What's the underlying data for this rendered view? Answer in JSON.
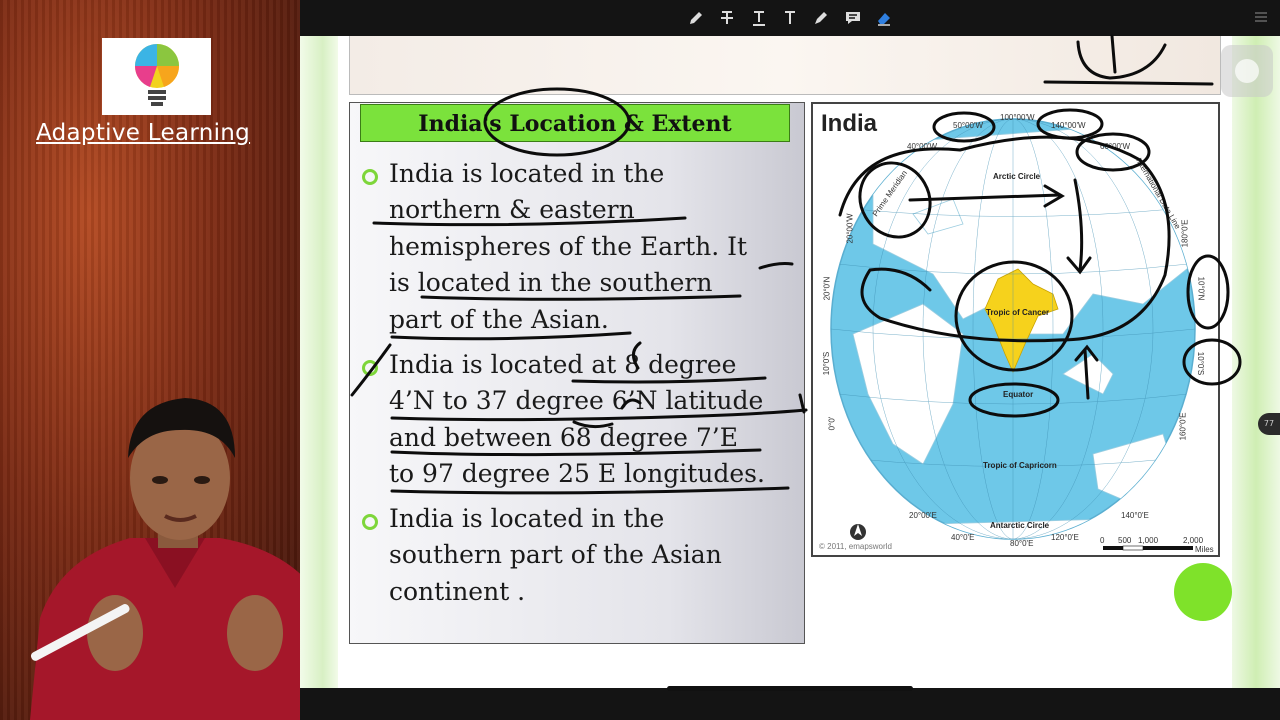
{
  "brand": {
    "name": "Adaptive Learning"
  },
  "toolbar": {
    "tools": [
      "pen-icon",
      "text-strike-icon",
      "text-underline-icon",
      "text-icon",
      "marker-icon",
      "comment-icon",
      "eraser-icon"
    ],
    "menu_icon": "menu-icon"
  },
  "slide": {
    "title": "India's Location & Extent",
    "bullets": [
      {
        "lines": [
          "India is located in the",
          "northern & eastern",
          "hemispheres of the Earth. It",
          "is located in the southern",
          "part of the Asian."
        ]
      },
      {
        "lines": [
          "India is located at 8 degree",
          "4’N to 37 degree 6’N latitude",
          "and between 68 degree 7’E",
          "to 97 degree 25 E longitudes."
        ]
      },
      {
        "lines": [
          "India is located in the",
          "southern part of the Asian",
          "continent ."
        ]
      }
    ]
  },
  "map": {
    "title": "India",
    "labels": {
      "deg50w": "50°00'W",
      "deg100w": "100°00'W",
      "deg140w": "140°00'W",
      "deg40w": "40°00'W",
      "deg60w": "60°00'W",
      "deg20w": "20°00'W",
      "arctic": "Arctic Circle",
      "prime": "Prime Meridian",
      "dateline": "International Date Line",
      "deg180e": "180°0'E",
      "deg20n": "20°0'N",
      "deg10n": "10°0'N",
      "deg10s": "10°0'S",
      "deg0": "0°0'",
      "cancer": "Tropic of Cancer",
      "equator": "Equator",
      "capricorn": "Tropic of Capricorn",
      "antarctic": "Antarctic Circle",
      "deg20e": "20°00'E",
      "deg40e": "40°0'E",
      "deg80e": "80°0'E",
      "deg120e": "120°0'E",
      "deg140e": "140°0'E",
      "deg160e": "160°0'E",
      "copyright": "© 2011, emapsworld",
      "scale_0": "0",
      "scale_500": "500",
      "scale_1000": "1,000",
      "scale_2000": "2,000",
      "scale_unit": "Miles"
    },
    "ocean_color": "#6ec8e8",
    "land_color": "#ffffff",
    "india_color": "#f6d21c"
  },
  "ui": {
    "page_badge": "77",
    "accent_green": "#7fe22a"
  }
}
